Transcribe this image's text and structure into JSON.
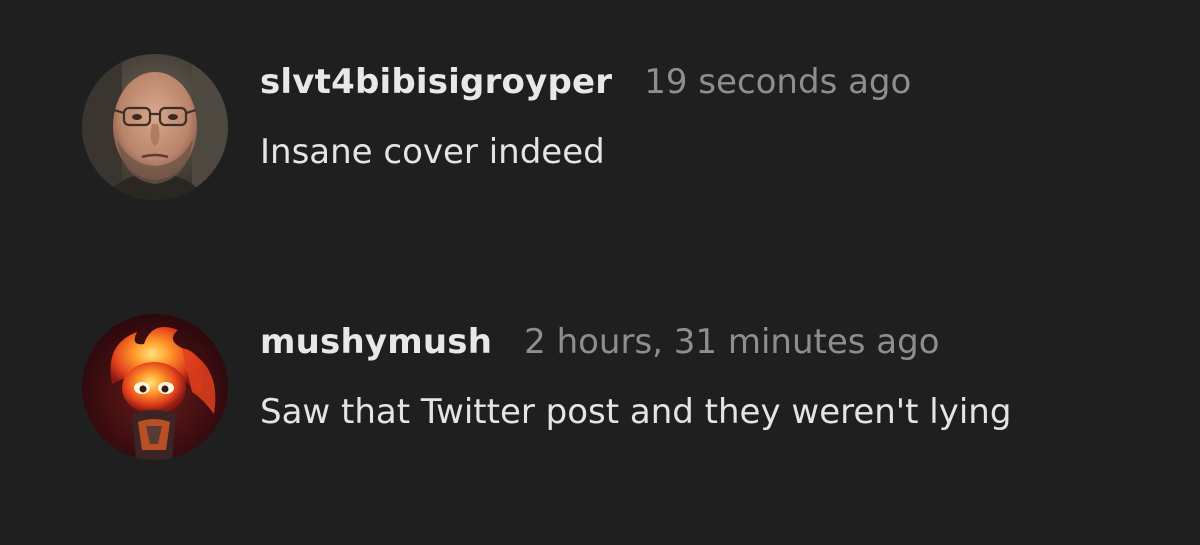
{
  "comments": [
    {
      "username": "slvt4bibisigroyper",
      "timestamp": "19 seconds ago",
      "text": "Insane cover indeed",
      "avatar": "avatar-man-glasses"
    },
    {
      "username": "mushymush",
      "timestamp": "2 hours, 31 minutes ago",
      "text": "Saw that Twitter post and they weren't lying",
      "avatar": "avatar-fire-character"
    }
  ],
  "colors": {
    "background": "#1f1f1f",
    "username": "#e8e8e8",
    "timestamp": "#8e8e8e",
    "text": "#e4e4e4"
  }
}
